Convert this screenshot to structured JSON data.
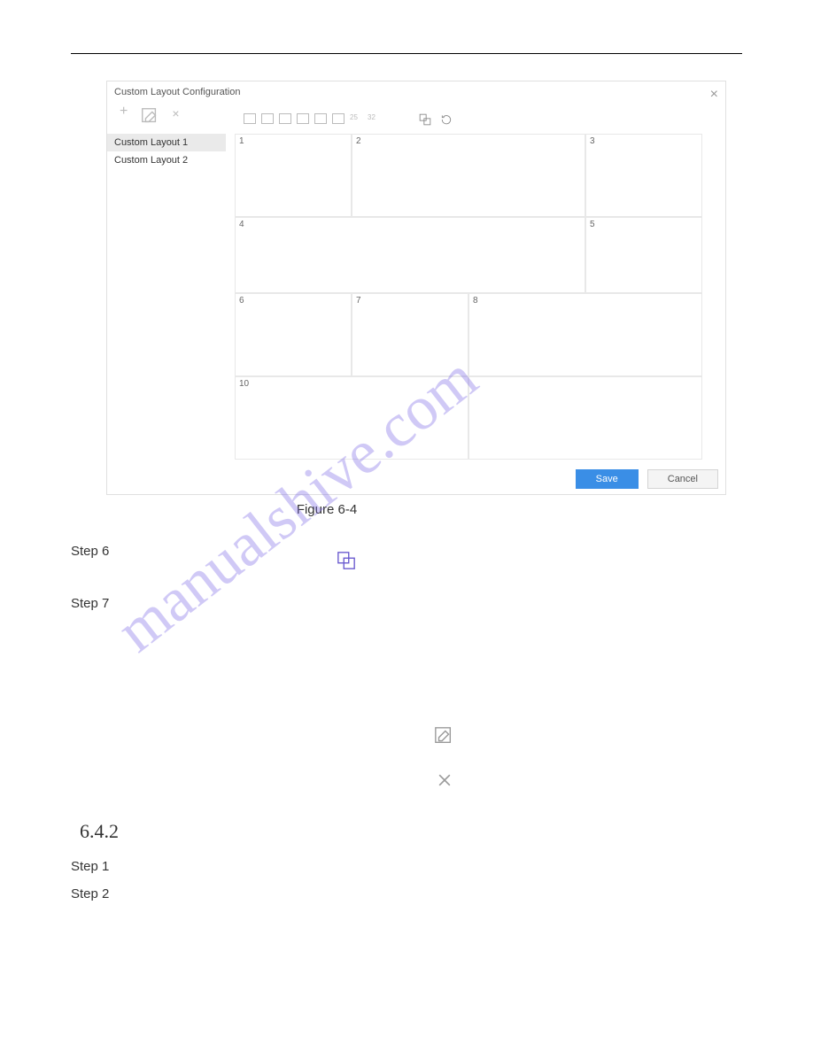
{
  "dialog": {
    "title": "Custom Layout Configuration",
    "sidebar": {
      "items": [
        {
          "label": "Custom Layout 1",
          "selected": true
        },
        {
          "label": "Custom Layout 2",
          "selected": false
        }
      ]
    },
    "cells": [
      "1",
      "2",
      "3",
      "4",
      "5",
      "6",
      "7",
      "8",
      "10"
    ],
    "buttons": {
      "save": "Save",
      "cancel": "Cancel"
    }
  },
  "caption": "Figure 6-4",
  "steps": {
    "s6": "Step 6",
    "s7": "Step 7",
    "s1": "Step 1",
    "s2": "Step 2"
  },
  "section": "6.4.2",
  "watermark": "manualshive.com"
}
